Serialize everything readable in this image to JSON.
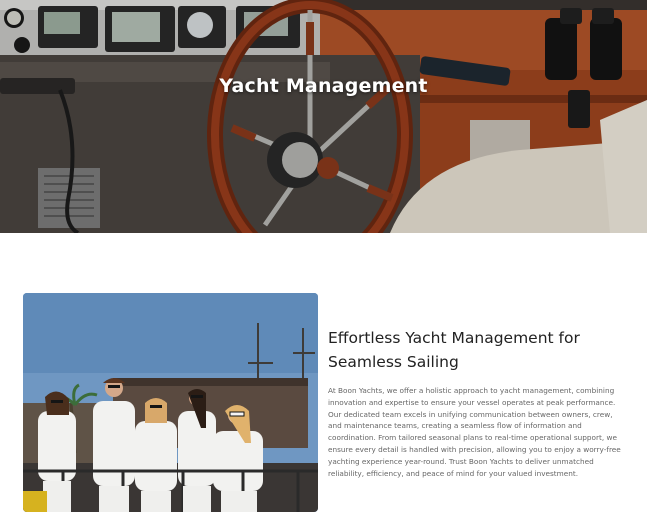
{
  "hero": {
    "title": "Yacht Management"
  },
  "section": {
    "heading_line1": "Effortless Yacht Management for",
    "heading_line2": "Seamless Sailing",
    "paragraph": "At Boon Yachts, we offer a holistic approach to yacht management, combining innovation and expertise to ensure your vessel operates at peak performance. Our dedicated team excels in unifying communication between owners, crew, and maintenance teams, creating a seamless flow of information and coordination. From tailored seasonal plans to real-time operational support, we ensure every detail is handled with precision, allowing you to enjoy a worry-free yachting experience year-round. Trust Boon Yachts to deliver unmatched reliability, efficiency, and peace of mind for your valued investment."
  },
  "colors": {
    "heading": "#222222",
    "body": "#666666",
    "hero_text": "#ffffff",
    "wood": "#8a3a1c"
  }
}
